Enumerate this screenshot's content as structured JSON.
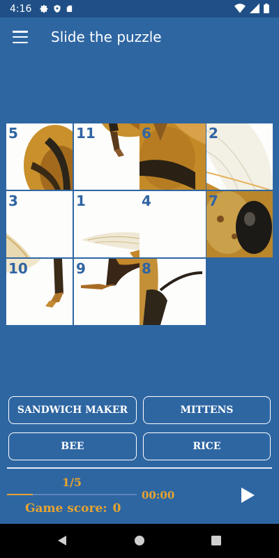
{
  "status": {
    "time": "4:16",
    "icons_left": [
      "gear-icon",
      "shield-icon",
      "sd-card-icon"
    ],
    "icons_right": [
      "wifi-icon",
      "signal-icon",
      "battery-icon"
    ]
  },
  "app_bar": {
    "menu_icon": "hamburger-menu-icon",
    "title": "Slide the puzzle"
  },
  "puzzle": {
    "grid": "4x3",
    "tiles": [
      {
        "number": "5"
      },
      {
        "number": "11"
      },
      {
        "number": "6"
      },
      {
        "number": "2"
      },
      {
        "number": "3"
      },
      {
        "number": "1"
      },
      {
        "number": "4"
      },
      {
        "number": "7"
      },
      {
        "number": "10"
      },
      {
        "number": "9"
      },
      {
        "number": "8"
      },
      {
        "number": ""
      }
    ]
  },
  "answers": [
    {
      "label": "SANDWICH MAKER"
    },
    {
      "label": "MITTENS"
    },
    {
      "label": "BEE"
    },
    {
      "label": "RICE"
    }
  ],
  "footer": {
    "progress_text": "1/5",
    "progress_fraction": 0.2,
    "timer": "00:00",
    "score_label": "Game score:",
    "score_value": "0",
    "play_icon": "play-icon"
  },
  "colors": {
    "background": "#2e66a2",
    "status_bar": "#1f4f86",
    "accent": "#e6a42f",
    "tile_number": "#2f64a3"
  },
  "nav": [
    "back-icon",
    "home-icon",
    "recents-icon"
  ]
}
